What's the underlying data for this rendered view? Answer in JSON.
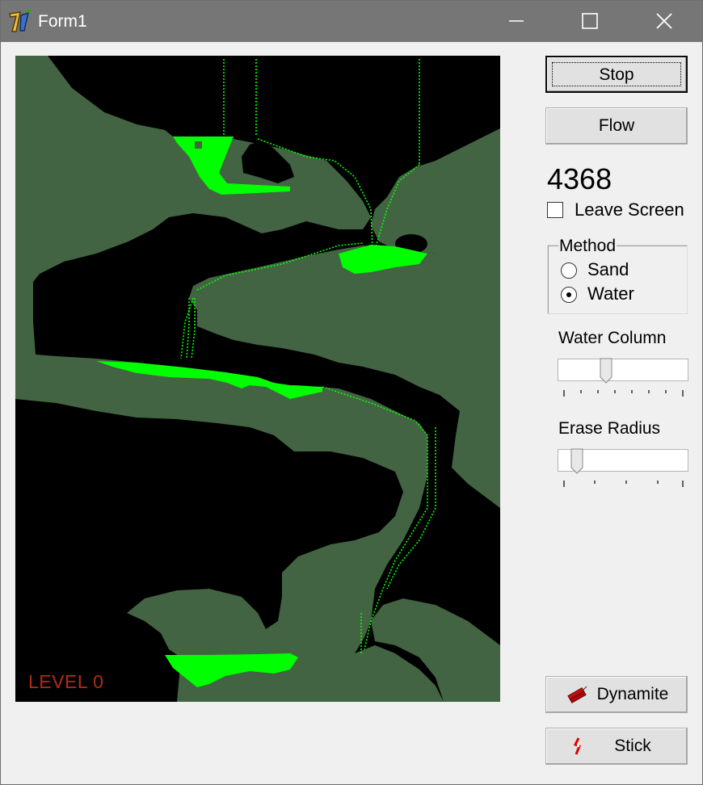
{
  "window": {
    "title": "Form1"
  },
  "title_buttons": {
    "minimize": "minimize",
    "maximize": "maximize",
    "close": "close"
  },
  "game": {
    "level_label": "LEVEL 0"
  },
  "controls": {
    "stop_label": "Stop",
    "flow_label": "Flow",
    "counter": "4368",
    "leave_screen_label": "Leave Screen",
    "leave_screen_checked": false,
    "method": {
      "label": "Method",
      "options": [
        {
          "label": "Sand",
          "selected": false
        },
        {
          "label": "Water",
          "selected": true
        }
      ]
    },
    "water_column": {
      "label": "Water Column",
      "value": 0.35
    },
    "erase_radius": {
      "label": "Erase Radius",
      "value": 0.1
    },
    "dynamite_label": "Dynamite",
    "stick_label": "Stick"
  },
  "colors": {
    "terrain": "#436443",
    "cavity": "#000000",
    "water": "#00ff00",
    "level_text": "#b22a16",
    "titlebar": "#767676"
  }
}
